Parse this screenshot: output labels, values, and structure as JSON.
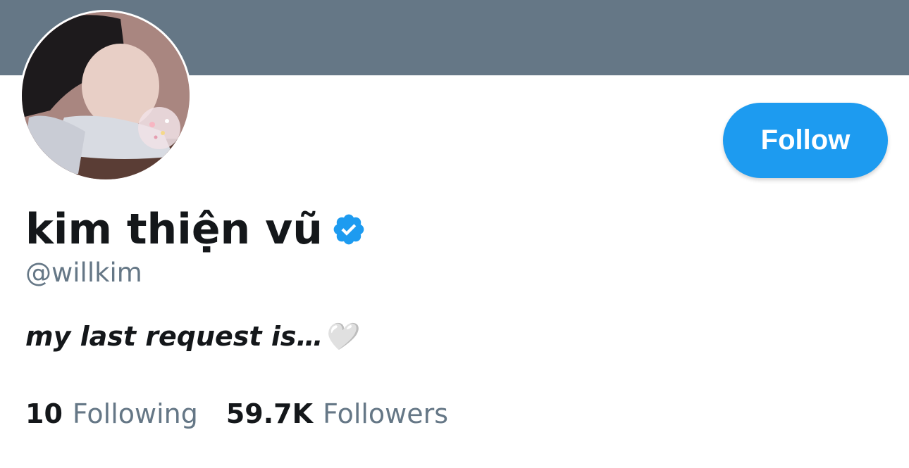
{
  "profile": {
    "display_name": "kim thiện vũ",
    "handle": "@willkim",
    "bio": "my last request is…🤍",
    "verified": true,
    "follow_label": "Follow",
    "banner_color": "#657786",
    "accent_color": "#1d9bf0",
    "stats": {
      "following_count": "10",
      "following_label": "Following",
      "followers_count": "59.7K",
      "followers_label": "Followers"
    }
  }
}
